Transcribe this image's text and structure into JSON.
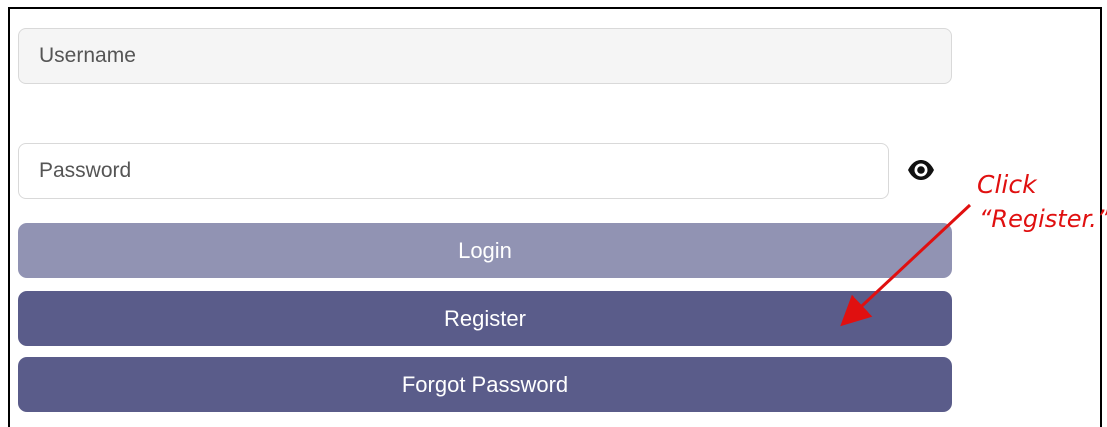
{
  "form": {
    "username": {
      "value": "",
      "placeholder": "Username"
    },
    "password": {
      "value": "",
      "placeholder": "Password"
    },
    "toggle_icon": "eye-icon",
    "buttons": {
      "login": "Login",
      "register": "Register",
      "forgot": "Forgot Password"
    }
  },
  "annotation": {
    "line1": "Click",
    "line2": "“Register.”",
    "color": "#e01010"
  },
  "colors": {
    "login_button": "#9193b3",
    "primary_button": "#5a5c8a"
  }
}
